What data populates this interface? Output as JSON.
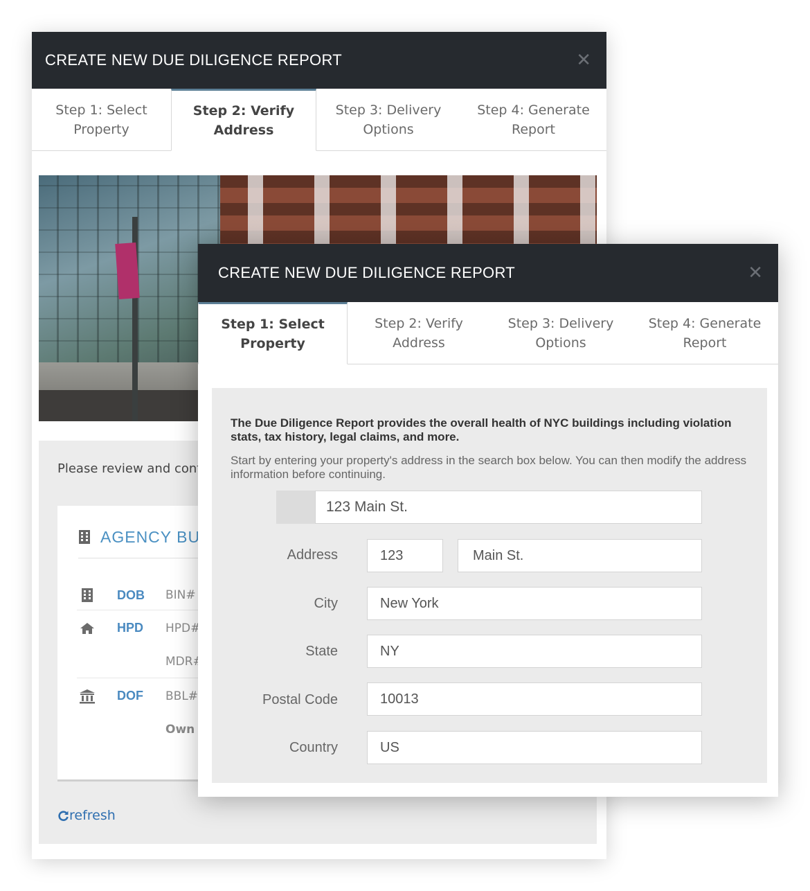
{
  "modal_title": "CREATE NEW DUE DILIGENCE REPORT",
  "close_symbol": "✕",
  "back_modal": {
    "tabs": [
      {
        "label": "Step 1: Select Property"
      },
      {
        "label": "Step 2: Verify Address"
      },
      {
        "label": "Step 3: Delivery Options"
      },
      {
        "label": "Step 4: Generate Report"
      }
    ],
    "active_tab": "Step 2: Verify Address",
    "review_text": "Please review and confi",
    "agency": {
      "title": "AGENCY BU",
      "title_icon": "building-icon",
      "rows": [
        {
          "icon": "building-icon",
          "name": "DOB",
          "field": "BIN#"
        },
        {
          "icon": "home-icon",
          "name": "HPD",
          "field": "HPD#"
        },
        {
          "icon": "",
          "name": "",
          "field": "MDR#"
        },
        {
          "icon": "bank-icon",
          "name": "DOF",
          "field": "BBL#"
        },
        {
          "icon": "",
          "name": "",
          "field": "Own"
        }
      ]
    },
    "refresh_label": "refresh",
    "refresh_icon": "refresh-icon"
  },
  "front_modal": {
    "tabs": [
      {
        "label": "Step 1: Select Property"
      },
      {
        "label": "Step 2: Verify Address"
      },
      {
        "label": "Step 3: Delivery Options"
      },
      {
        "label": "Step 4: Generate Report"
      }
    ],
    "active_tab": "Step 1: Select Property",
    "intro_bold": "The Due Diligence Report provides the overall health of NYC buildings including violation stats, tax history, legal claims, and more.",
    "intro_text": "Start by entering your property's address in the search box below. You can then modify the address information before continuing.",
    "search_value": "123 Main St.",
    "form": {
      "address_label": "Address",
      "address_number": "123",
      "address_street": "Main St.",
      "city_label": "City",
      "city_value": "New York",
      "state_label": "State",
      "state_value": "NY",
      "postal_label": "Postal Code",
      "postal_value": "10013",
      "country_label": "Country",
      "country_value": "US"
    }
  },
  "colors": {
    "header_bg": "#262a2f",
    "accent_blue": "#4a90c2",
    "active_tab_border": "#5c7f96",
    "panel_bg": "#ebebeb"
  }
}
